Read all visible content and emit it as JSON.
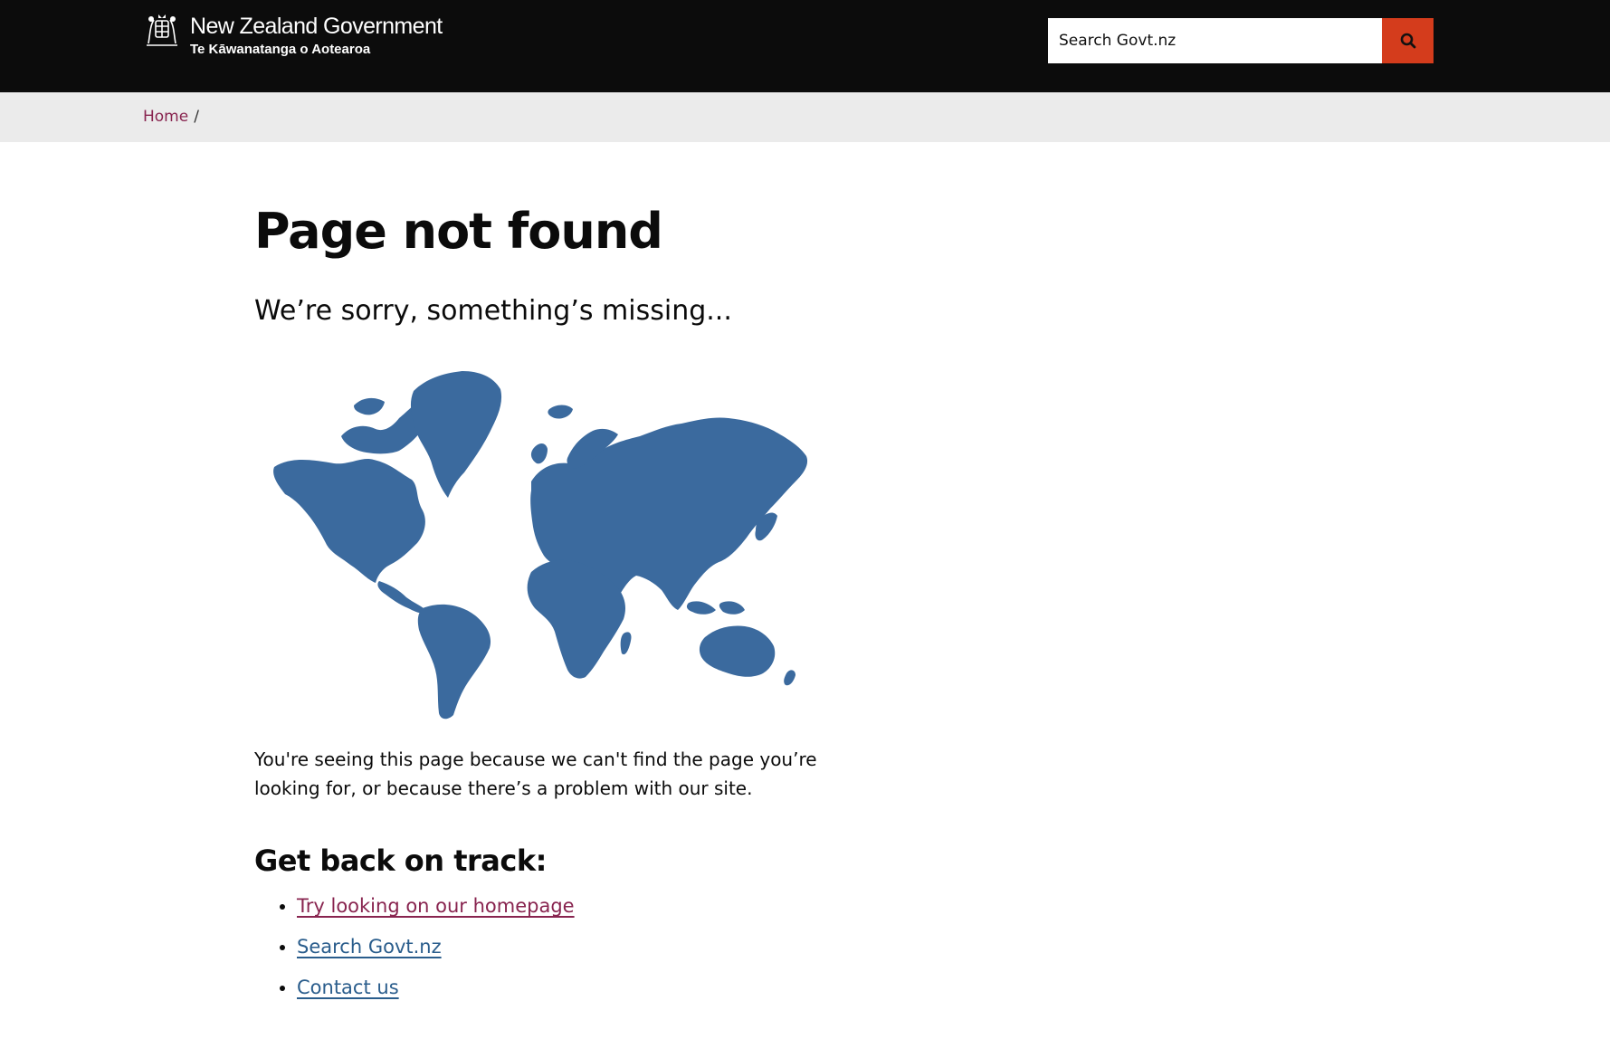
{
  "header": {
    "logo_title": "New Zealand Government",
    "logo_subtitle": "Te Kāwanatanga o Aotearoa",
    "search_placeholder": "Search Govt.nz",
    "search_button_icon": "search-icon"
  },
  "breadcrumb": {
    "home_label": "Home",
    "separator": "/"
  },
  "main": {
    "title": "Page not found",
    "lead": "We’re sorry, something’s missing...",
    "map_color": "#3b6a9e",
    "body": "You're seeing this page because we can't find the page you’re looking for, or because there’s a problem with our site.",
    "subheading": "Get back on track:",
    "links": [
      {
        "label": "Try looking on our homepage"
      },
      {
        "label": "Search Govt.nz"
      },
      {
        "label": "Contact us"
      }
    ]
  },
  "colors": {
    "header_bg": "#0c0c0c",
    "search_button": "#d43c1c",
    "breadcrumb_bg": "#ebebeb",
    "link_visited": "#88244f",
    "link": "#2a5d8c"
  }
}
